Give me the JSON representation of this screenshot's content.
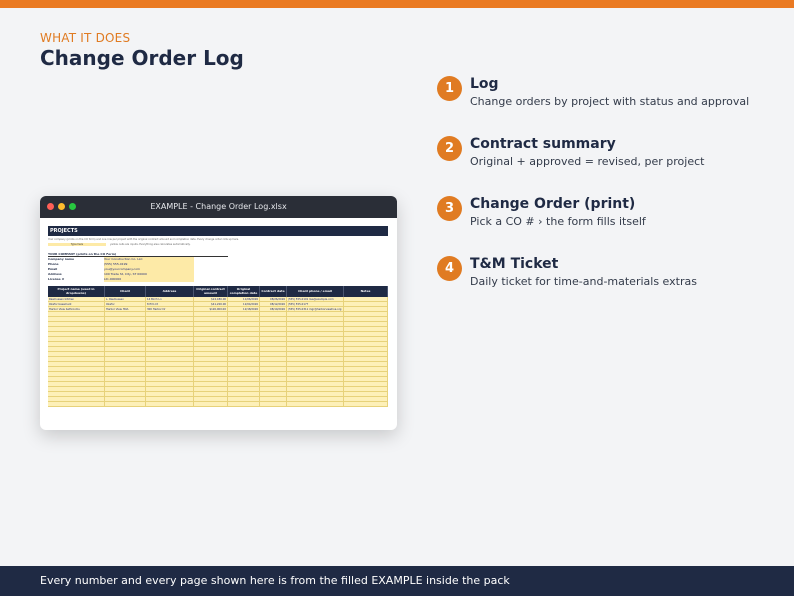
{
  "header": {
    "eyebrow": "WHAT IT DOES",
    "title": "Change Order Log"
  },
  "window": {
    "title": "EXAMPLE - Change Order Log.xlsx",
    "section_title": "PROJECTS",
    "note": "Your company (prints on the CO form) and one row per project with the original contract amount and completion date. Every change order rolls up here.",
    "type_here_label": "Type here",
    "type_here_note": "yellow cells are inputs. Everything else calculates automatically.",
    "company_heading": "YOUR COMPANY (prints on the CO Form)",
    "company": [
      {
        "label": "Company name",
        "value": "Your Construction Co. LLC"
      },
      {
        "label": "Phone",
        "value": "(555) 555-0199"
      },
      {
        "label": "Email",
        "value": "you@yourcompany.com"
      },
      {
        "label": "Address",
        "value": "100 Trade St, City, ST 00000"
      },
      {
        "label": "License #",
        "value": "LIC-000000"
      }
    ],
    "columns": [
      "Project name (used in dropdowns)",
      "Client",
      "Address",
      "Original contract amount",
      "Original completion date",
      "Contract date",
      "Client phone / email",
      "Notes"
    ],
    "rows": [
      [
        "Rasmussen kitchen",
        "L. Rasmussen",
        "14 Birch Ln",
        "$24,480.00",
        "11/06/2026",
        "08/26/2026",
        "(555) 555-0101 lisa@example.com",
        ""
      ],
      [
        "Okafor basement",
        "Okafor",
        "8 Elm Ct",
        "$41,200.00",
        "12/04/2026",
        "08/12/2026",
        "(555) 555-0177",
        ""
      ],
      [
        "Harbor View bathrooms",
        "Harbor View HOA",
        "300 Harbor Dr",
        "$126,000.00",
        "12/18/2026",
        "08/10/2026",
        "(555) 555-0311 mgr@harborviewhoa.org",
        ""
      ]
    ],
    "empty_row_count": 19
  },
  "features": [
    {
      "number": "1",
      "title": "Log",
      "description": "Change orders by project with status and approval"
    },
    {
      "number": "2",
      "title": "Contract summary",
      "description": "Original + approved = revised, per project"
    },
    {
      "number": "3",
      "title": "Change Order (print)",
      "description": "Pick a CO # › the form fills itself"
    },
    {
      "number": "4",
      "title": "T&M Ticket",
      "description": "Daily ticket for time-and-materials extras"
    }
  ],
  "footer": {
    "text": "Every number and every page shown here is from the filled EXAMPLE inside the pack"
  },
  "colors": {
    "accent": "#e07b22",
    "navy": "#1f2a44",
    "input_yellow": "#fdeaa7"
  }
}
